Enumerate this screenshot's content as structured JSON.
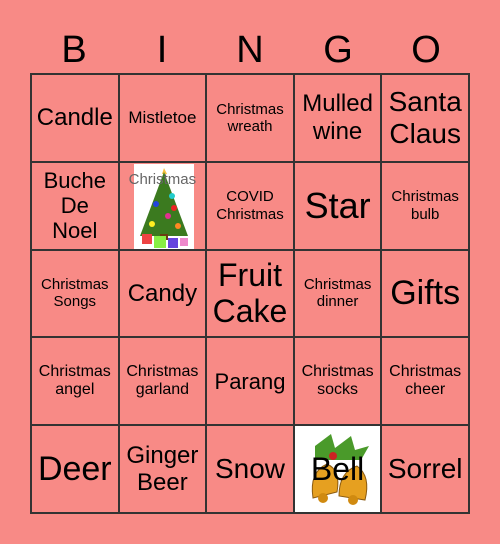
{
  "header": [
    "B",
    "I",
    "N",
    "G",
    "O"
  ],
  "cells": [
    {
      "text": "Candle",
      "size": 24
    },
    {
      "text": "Mistletoe",
      "size": 17
    },
    {
      "text": "Christmas wreath",
      "size": 15
    },
    {
      "text": "Mulled wine",
      "size": 24
    },
    {
      "text": "Santa Claus",
      "size": 28
    },
    {
      "text": "Buche De Noel",
      "size": 22
    },
    {
      "text": "Christmas",
      "size": 15,
      "image": "christmas-tree",
      "free": true
    },
    {
      "text": "COVID Christmas",
      "size": 15
    },
    {
      "text": "Star",
      "size": 36
    },
    {
      "text": "Christmas bulb",
      "size": 15
    },
    {
      "text": "Christmas Songs",
      "size": 15
    },
    {
      "text": "Candy",
      "size": 24
    },
    {
      "text": "Fruit Cake",
      "size": 32
    },
    {
      "text": "Christmas dinner",
      "size": 15
    },
    {
      "text": "Gifts",
      "size": 34
    },
    {
      "text": "Christmas angel",
      "size": 16
    },
    {
      "text": "Christmas garland",
      "size": 16
    },
    {
      "text": "Parang",
      "size": 22
    },
    {
      "text": "Christmas socks",
      "size": 16
    },
    {
      "text": "Christmas cheer",
      "size": 16
    },
    {
      "text": "Deer",
      "size": 34
    },
    {
      "text": "Ginger Beer",
      "size": 24
    },
    {
      "text": "Snow",
      "size": 28
    },
    {
      "text": "Bell",
      "size": 32,
      "image": "christmas-bells"
    },
    {
      "text": "Sorrel",
      "size": 28
    }
  ],
  "colors": {
    "background": "#f88a86",
    "grid": "#333333"
  }
}
